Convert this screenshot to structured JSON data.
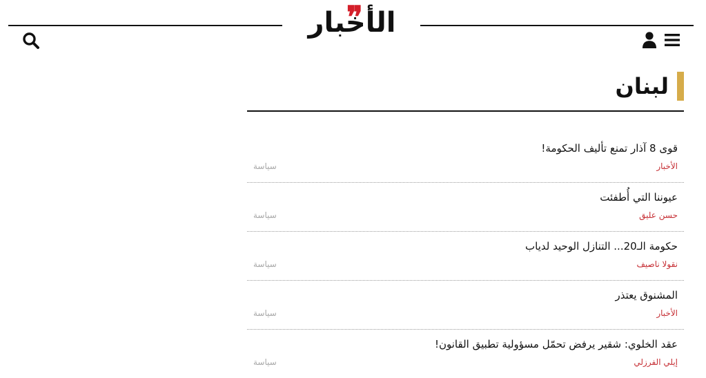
{
  "header": {
    "logo_text": "الأخبار",
    "logo_mark": "❞",
    "search_icon": "search-icon",
    "user_icon": "user-icon",
    "menu_icon": "hamburger-menu-icon"
  },
  "section": {
    "title": "لبنان"
  },
  "articles": [
    {
      "title": "قوى 8 آذار تمنع تأليف الحكومة!",
      "author": "الأخبار",
      "category": "سياسة"
    },
    {
      "title": "عيوننا التي أُطفئت",
      "author": "حسن عليق",
      "category": "سياسة"
    },
    {
      "title": "حكومة الـ20... التنازل الوحيد لدياب",
      "author": "نقولا ناصيف",
      "category": "سياسة"
    },
    {
      "title": "المشنوق يعتذر",
      "author": "الأخبار",
      "category": "سياسة"
    },
    {
      "title": "عقد الخلوي: شقير يرفض تحمّل مسؤولية تطبيق القانون!",
      "author": "إيلي الفرزلي",
      "category": "سياسة"
    }
  ],
  "colors": {
    "text": "#111111",
    "brand_red": "#d41f2a",
    "author_red": "#c62f35",
    "category_gray": "#a8a8a8",
    "section_accent": "#d6ac4a"
  }
}
